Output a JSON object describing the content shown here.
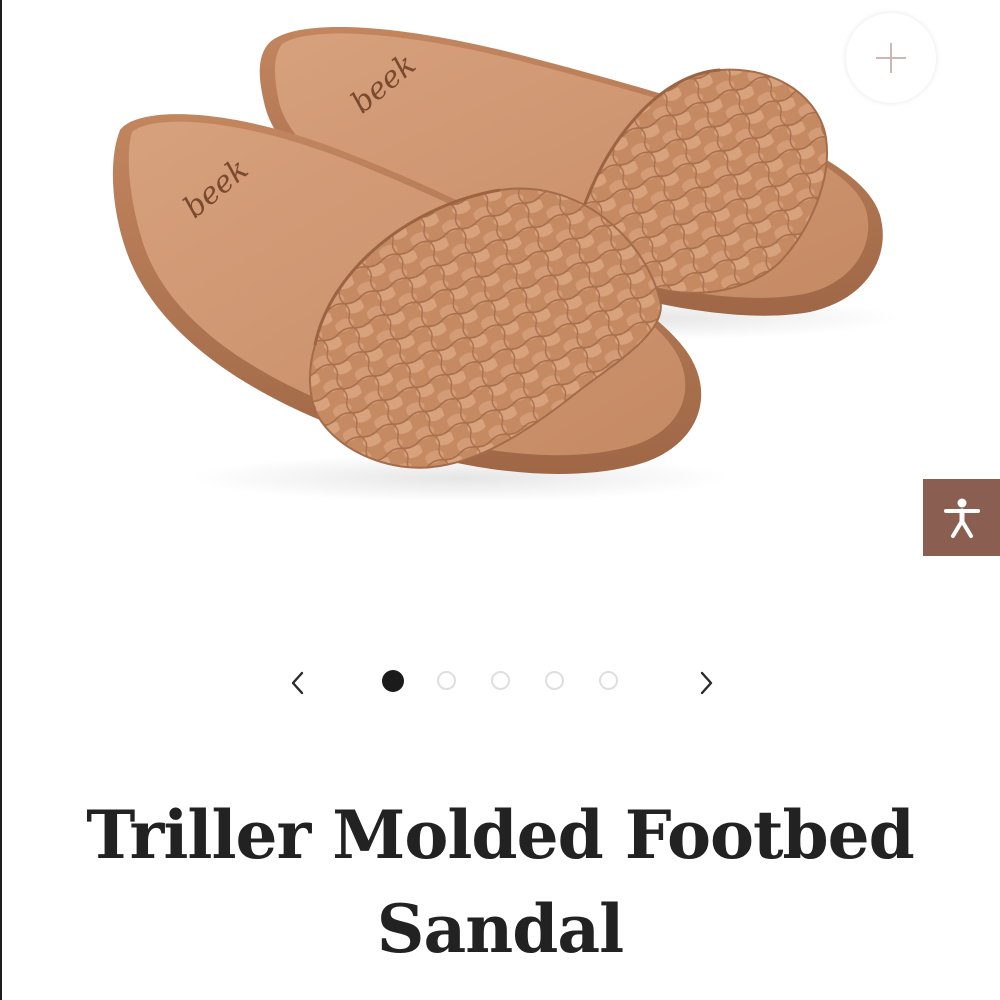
{
  "product": {
    "title": "Triller Molded Footbed Sandal",
    "image": {
      "alt": "Triller Molded Footbed Sandal",
      "brand_mark": "beek"
    }
  },
  "controls": {
    "zoom_icon": "plus-icon",
    "accessibility_icon": "accessibility-person-icon"
  },
  "carousel": {
    "prev_icon": "chevron-left-icon",
    "next_icon": "chevron-right-icon",
    "slide_count": 5,
    "active_slide": 1
  },
  "colors": {
    "sandal_tan": "#c98e69",
    "accessibility_button": "#8a5f52",
    "active_dot": "#1b1b1b",
    "inactive_dot_border": "#dedede",
    "title_text": "#222222"
  }
}
